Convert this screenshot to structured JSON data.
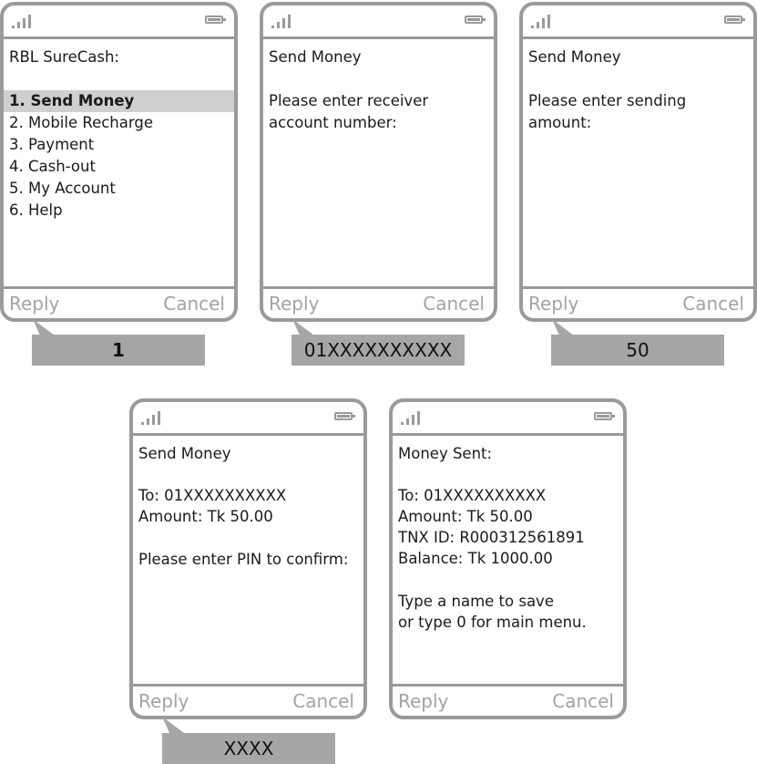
{
  "softkeys": {
    "reply": "Reply",
    "cancel": "Cancel"
  },
  "screens": [
    {
      "lines": [
        "RBL SureCash:",
        "1. Send Money",
        "2. Mobile Recharge",
        "3. Payment",
        "4. Cash-out",
        "5. My Account",
        "6. Help"
      ],
      "input": "1"
    },
    {
      "lines": [
        "Send Money",
        "Please enter receiver",
        "account number:"
      ],
      "input": "01XXXXXXXXXX"
    },
    {
      "lines": [
        "Send Money",
        "Please enter sending",
        "amount:"
      ],
      "input": "50"
    },
    {
      "lines": [
        "Send Money",
        "To: 01XXXXXXXXXX",
        "Amount: Tk 50.00",
        "Please enter PIN to confirm:"
      ],
      "input": "XXXX"
    },
    {
      "lines": [
        "Money Sent:",
        "To: 01XXXXXXXXXX",
        "Amount: Tk 50.00",
        "TNX ID: R000312561891",
        "Balance: Tk 1000.00",
        "Type a name to save",
        "or type 0 for main menu."
      ]
    }
  ]
}
